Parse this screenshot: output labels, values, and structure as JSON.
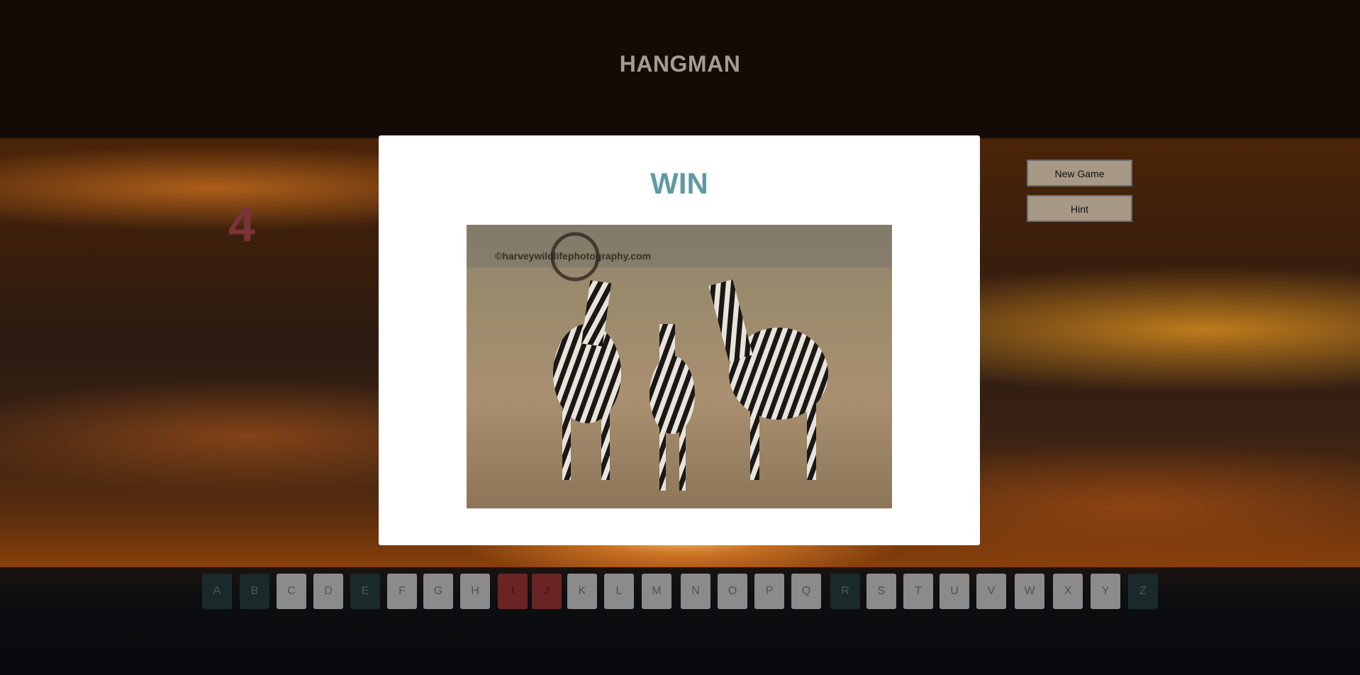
{
  "app": {
    "title": "HANGMAN"
  },
  "status": {
    "remaining_guesses": "4"
  },
  "controls": {
    "new_game_label": "New Game",
    "hint_label": "Hint"
  },
  "modal": {
    "result": "WIN",
    "image_subject": "three zebras in savanna grass",
    "watermark": "©harveywildlifephotography.com"
  },
  "keyboard": {
    "keys": [
      {
        "letter": "A",
        "state": "correct"
      },
      {
        "letter": "B",
        "state": "correct"
      },
      {
        "letter": "C",
        "state": "unused"
      },
      {
        "letter": "D",
        "state": "unused"
      },
      {
        "letter": "E",
        "state": "correct"
      },
      {
        "letter": "F",
        "state": "unused"
      },
      {
        "letter": "G",
        "state": "unused"
      },
      {
        "letter": "H",
        "state": "unused"
      },
      {
        "letter": "I",
        "state": "wrong"
      },
      {
        "letter": "J",
        "state": "wrong"
      },
      {
        "letter": "K",
        "state": "unused"
      },
      {
        "letter": "L",
        "state": "unused"
      },
      {
        "letter": "M",
        "state": "unused"
      },
      {
        "letter": "N",
        "state": "unused"
      },
      {
        "letter": "O",
        "state": "unused"
      },
      {
        "letter": "P",
        "state": "unused"
      },
      {
        "letter": "Q",
        "state": "unused"
      },
      {
        "letter": "R",
        "state": "correct"
      },
      {
        "letter": "S",
        "state": "unused"
      },
      {
        "letter": "T",
        "state": "unused"
      },
      {
        "letter": "U",
        "state": "unused"
      },
      {
        "letter": "V",
        "state": "unused"
      },
      {
        "letter": "W",
        "state": "unused"
      },
      {
        "letter": "X",
        "state": "unused"
      },
      {
        "letter": "Y",
        "state": "unused"
      },
      {
        "letter": "Z",
        "state": "correct"
      }
    ]
  },
  "colors": {
    "title": "#a59a97",
    "counter": "#7a3336",
    "win": "#5f9aa3",
    "key_unused": "#8b8b8b",
    "key_correct": "#1a2a2a",
    "key_wrong": "#6a2424"
  }
}
